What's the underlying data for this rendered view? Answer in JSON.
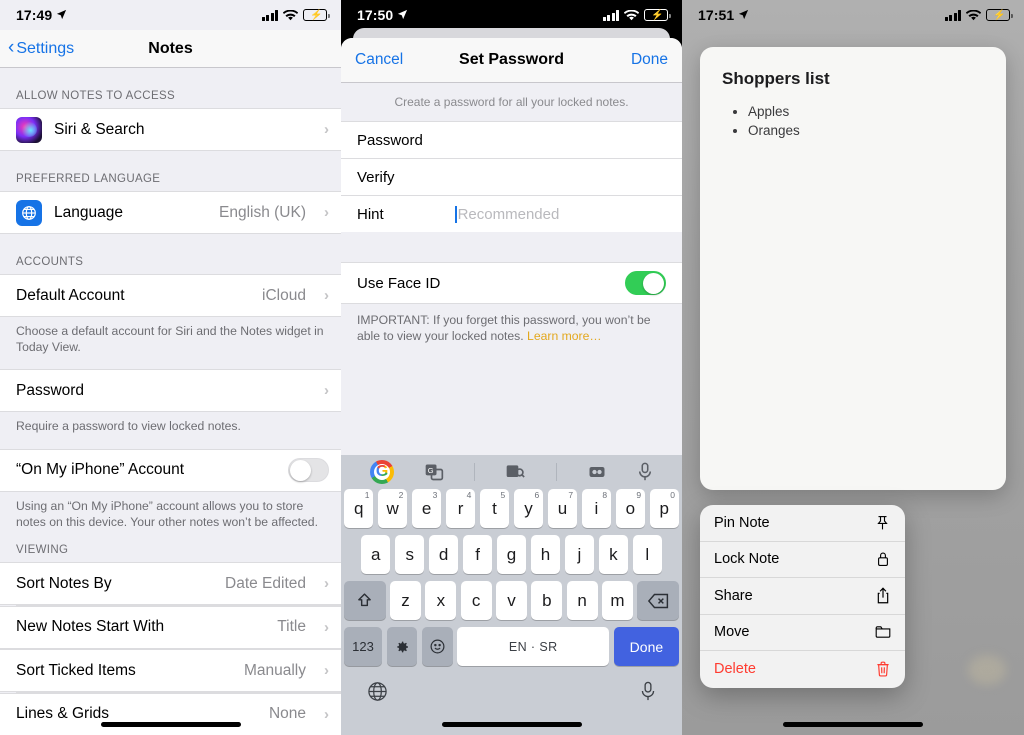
{
  "panel1": {
    "status": {
      "time": "17:49",
      "location_icon": "location-arrow-icon",
      "signal_icon": "cellular-bars-icon",
      "wifi_icon": "wifi-icon",
      "battery_icon": "battery-charging-icon"
    },
    "nav": {
      "back_label": "Settings",
      "title": "Notes"
    },
    "sections": [
      {
        "header": "ALLOW NOTES TO ACCESS",
        "rows": [
          {
            "label": "Siri & Search",
            "value": "",
            "icon": "siri-icon",
            "accessory": "chevron"
          }
        ],
        "footnote": ""
      },
      {
        "header": "PREFERRED LANGUAGE",
        "rows": [
          {
            "label": "Language",
            "value": "English (UK)",
            "icon": "globe-icon",
            "accessory": "chevron"
          }
        ],
        "footnote": ""
      },
      {
        "header": "ACCOUNTS",
        "rows": [
          {
            "label": "Default Account",
            "value": "iCloud",
            "icon": "",
            "accessory": "chevron"
          }
        ],
        "footnote": "Choose a default account for Siri and the Notes widget in Today View."
      },
      {
        "header": "",
        "rows": [
          {
            "label": "Password",
            "value": "",
            "icon": "",
            "accessory": "chevron"
          }
        ],
        "footnote": "Require a password to view locked notes."
      },
      {
        "header": "",
        "rows": [
          {
            "label": "“On My iPhone” Account",
            "value": "",
            "icon": "",
            "accessory": "switch-off"
          }
        ],
        "footnote": "Using an “On My iPhone” account allows you to store notes on this device. Your other notes won’t be affected."
      },
      {
        "header": "VIEWING",
        "rows": [
          {
            "label": "Sort Notes By",
            "value": "Date Edited",
            "icon": "",
            "accessory": "chevron"
          },
          {
            "label": "New Notes Start With",
            "value": "Title",
            "icon": "",
            "accessory": "chevron"
          },
          {
            "label": "Sort Ticked Items",
            "value": "Manually",
            "icon": "",
            "accessory": "chevron"
          },
          {
            "label": "Lines & Grids",
            "value": "None",
            "icon": "",
            "accessory": "chevron"
          }
        ],
        "footnote": ""
      }
    ]
  },
  "panel2": {
    "status": {
      "time": "17:50"
    },
    "sheet": {
      "cancel_label": "Cancel",
      "title": "Set Password",
      "done_label": "Done",
      "note": "Create a password for all your locked notes.",
      "fields": [
        {
          "label": "Password",
          "value": "",
          "placeholder": ""
        },
        {
          "label": "Verify",
          "value": "",
          "placeholder": ""
        },
        {
          "label": "Hint",
          "value": "",
          "placeholder": "Recommended"
        }
      ],
      "faceid": {
        "label": "Use Face ID",
        "state": "on"
      },
      "important_prefix": "IMPORTANT: If you forget this password, you won’t be able to view your locked notes. ",
      "important_link": "Learn more…"
    },
    "keyboard": {
      "toolbar": [
        {
          "name": "google-logo-icon",
          "glyph": "G"
        },
        {
          "name": "translate-icon",
          "glyph": "文"
        },
        {
          "name": "image-search-icon",
          "glyph": "▣"
        },
        {
          "name": "sticker-icon",
          "glyph": "▭"
        },
        {
          "name": "microphone-icon",
          "glyph": "Ἲ4"
        }
      ],
      "row1": [
        {
          "key": "q",
          "sup": "1"
        },
        {
          "key": "w",
          "sup": "2"
        },
        {
          "key": "e",
          "sup": "3"
        },
        {
          "key": "r",
          "sup": "4"
        },
        {
          "key": "t",
          "sup": "5"
        },
        {
          "key": "y",
          "sup": "6"
        },
        {
          "key": "u",
          "sup": "7"
        },
        {
          "key": "i",
          "sup": "8"
        },
        {
          "key": "o",
          "sup": "9"
        },
        {
          "key": "p",
          "sup": "0"
        }
      ],
      "row2": [
        "a",
        "s",
        "d",
        "f",
        "g",
        "h",
        "j",
        "k",
        "l"
      ],
      "row3": [
        "z",
        "x",
        "c",
        "v",
        "b",
        "n",
        "m"
      ],
      "shift_label": "⇧",
      "delete_label": "⌫",
      "num_label": "123",
      "gear_label": "⚙",
      "emoji_label": "☺",
      "space_label": "EN · SR",
      "done_label": "Done",
      "globe_label": "⊕",
      "mic_label": "Ἲ4"
    }
  },
  "panel3": {
    "status": {
      "time": "17:51"
    },
    "note": {
      "title": "Shoppers list",
      "items": [
        "Apples",
        "Oranges"
      ]
    },
    "context_menu": [
      {
        "label": "Pin Note",
        "icon": "pin-icon",
        "danger": false
      },
      {
        "label": "Lock Note",
        "icon": "lock-icon",
        "danger": false
      },
      {
        "label": "Share",
        "icon": "share-icon",
        "danger": false
      },
      {
        "label": "Move",
        "icon": "folder-icon",
        "danger": false
      },
      {
        "label": "Delete",
        "icon": "trash-icon",
        "danger": true
      }
    ]
  },
  "colors": {
    "accent_blue": "#1673e6",
    "switch_green": "#32cd56",
    "destructive_red": "#ff3b30",
    "link_amber": "#e3a81e",
    "keyboard_done_blue": "#4262e0"
  }
}
